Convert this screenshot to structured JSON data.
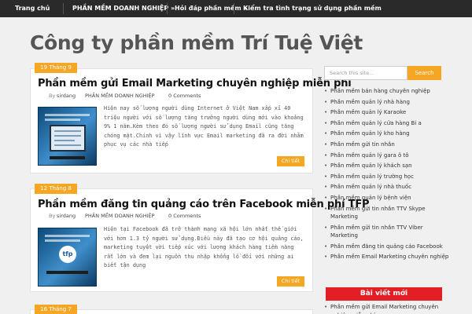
{
  "nav": {
    "items": [
      {
        "label": "Trang chủ"
      },
      {
        "label": "PHẦN MỀM DOANH NGHIỆP »"
      },
      {
        "label": "Hỏi đáp phần mềm »"
      },
      {
        "label": "Kiểm tra tình trạng sử dụng phần mềm"
      }
    ]
  },
  "site_title": "Công ty phần mềm Trí Tuệ Việt",
  "posts": [
    {
      "date": "19 Tháng 9",
      "title": "Phần mềm gửi Email Marketing chuyên nghiệp miễn phí",
      "by": "By",
      "author": "sirdang",
      "category": "PHẦN MỀM DOANH NGHIỆP",
      "comments": "0 Comments",
      "excerpt": "Hiện nay số lượng người dùng Internet ở Việt Nam xấp xỉ 40 triệu người với số lượng tăng trưởng người dùng mới vào khoảng 9% 1 năm.Kèm theo đó số lượng người sử dụng Email cũng tăng chóng mặt.Chính vì vậy lĩnh vực Email marketing đã ra đời nhằm phục vụ các nhà tiếp",
      "read_more": "Chi tiết"
    },
    {
      "date": "12 Tháng 8",
      "title": "Phần mềm đăng tin quảng cáo trên Facebook miễn phí TFP",
      "by": "By",
      "author": "sirdang",
      "category": "PHẦN MỀM DOANH NGHIỆP",
      "comments": "0 Comments",
      "excerpt": "Hiện tại Facebook đã trở thành mạng xã hội lớn nhất thế giới với hơn 1.3 tỷ người sử dụng.Điều này đã tạo cơ hội quảng cáo, marketing tuyệt vời tiếp xúc với lượng khách hàng tiềm năng rất lớn và đem lại nguồn thu nhập khổng lồ đối với những ai biết tận dụng",
      "read_more": "Chi tiết"
    },
    {
      "date": "16 Tháng 7"
    }
  ],
  "search": {
    "placeholder": "Search this site...",
    "button": "Search"
  },
  "sidebar": {
    "items": [
      "Phần mềm bán hàng chuyên nghiệp",
      "Phần mềm quản lý nhà hàng",
      "Phần mềm quản lý Karaoke",
      "Phần mềm quản lý cửa hàng Bi a",
      "Phần mềm quản lý kho hàng",
      "Phần mềm gửi tin nhắn",
      "Phần mềm quản lý gara ô tô",
      "Phần mềm quản lý khách sạn",
      "Phần mềm quản lý trường học",
      "Phần mềm quản lý nhà thuốc",
      "Phần mềm quản lý bệnh viện",
      "Phần mềm gửi tin nhắn TTV Skype Marketing",
      "Phần mềm gửi tin nhắn TTV Viber Marketing",
      "Phần mềm đăng tin quảng cáo Facebook",
      "Phần mềm Email Marketing chuyên nghiệp"
    ]
  },
  "recent": {
    "title": "Bài viết mới",
    "items": [
      "Phần mềm gửi Email Marketing chuyên nghiệp miễn phí"
    ]
  },
  "colors": {
    "accent": "#f5a623",
    "nav_bg": "#2a2a2a",
    "widget_title_bg": "#e31e24",
    "page_bg": "#f0f0f0"
  }
}
